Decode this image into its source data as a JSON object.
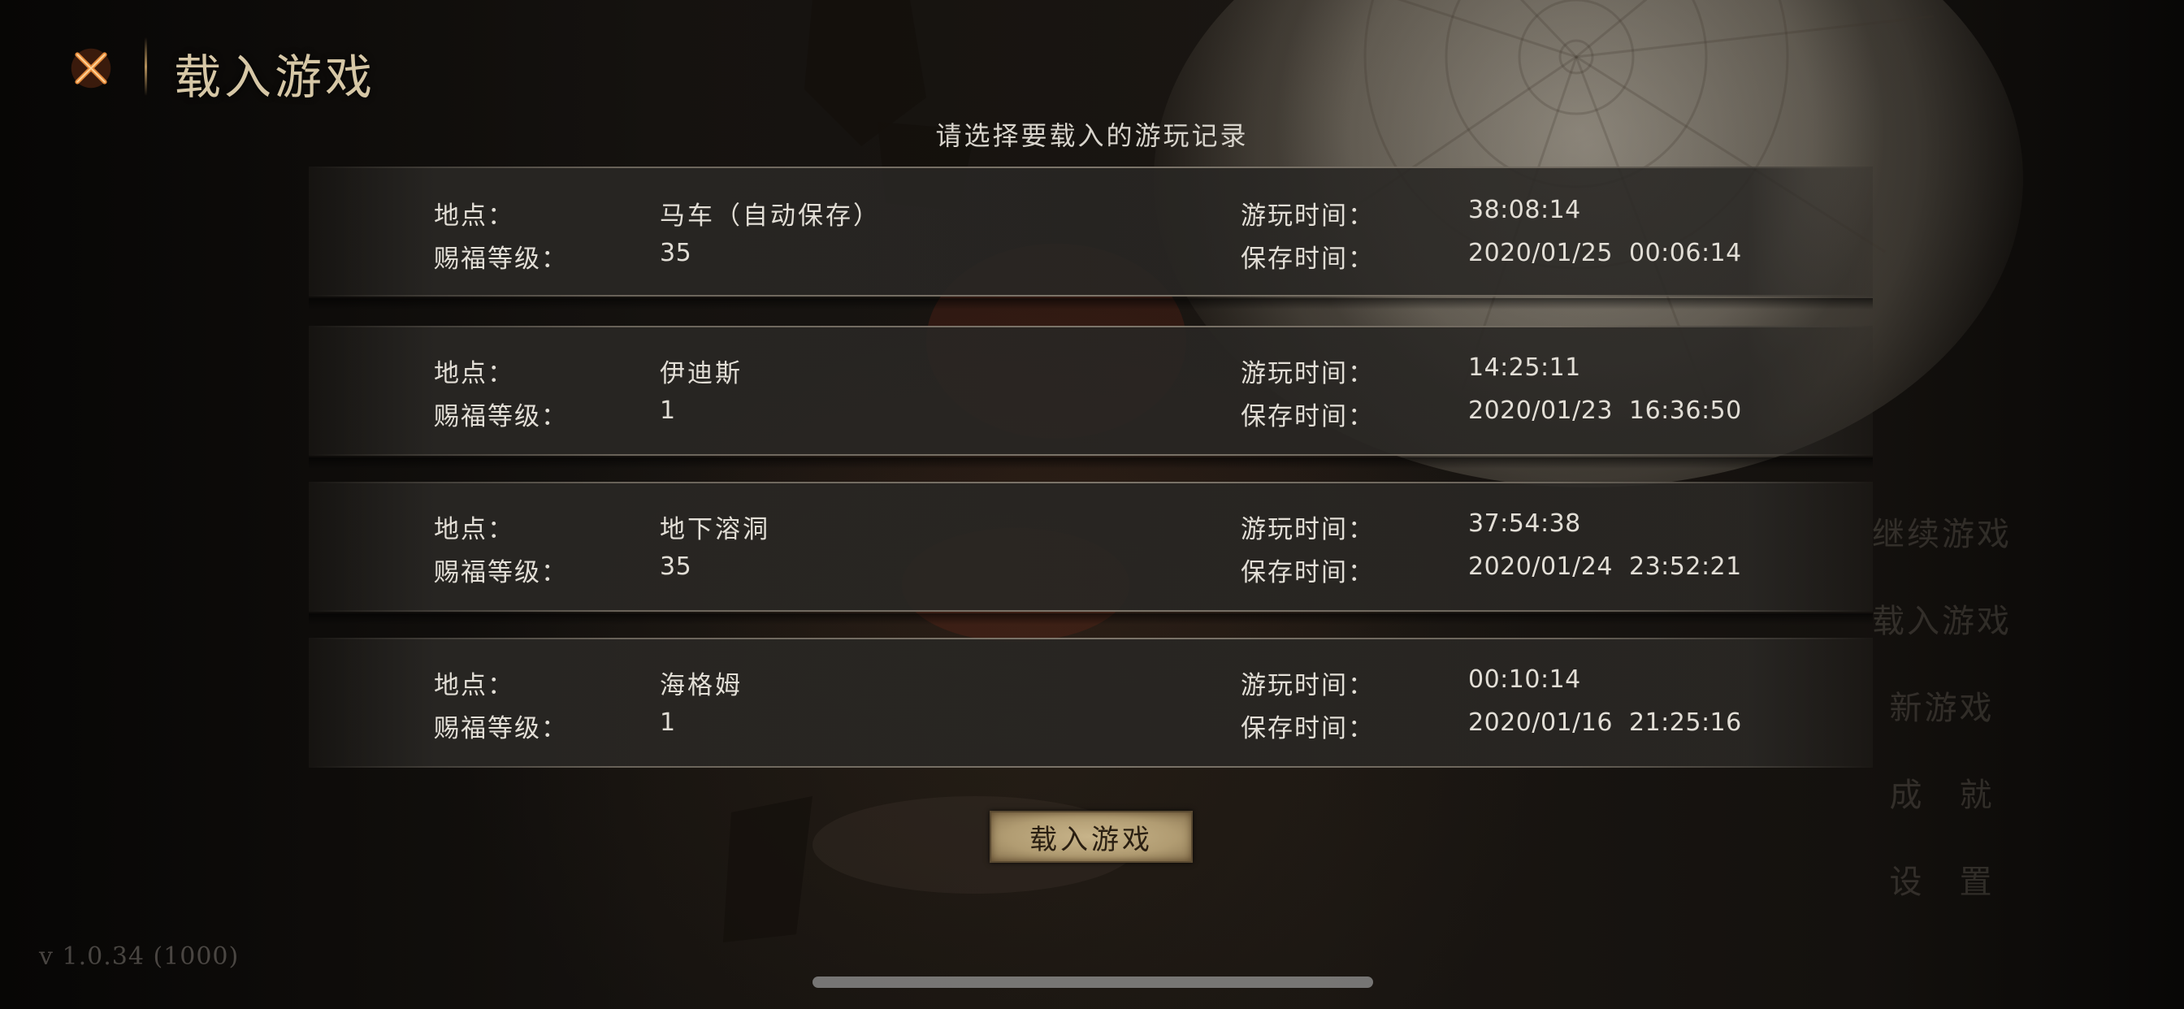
{
  "header": {
    "title": "载入游戏",
    "close_icon": "close-x-icon"
  },
  "subtitle": "请选择要载入的游玩记录",
  "labels": {
    "location": "地点：",
    "level": "赐福等级：",
    "play_time": "游玩时间：",
    "save_time": "保存时间："
  },
  "save_slots": [
    {
      "location": "马车（自动保存）",
      "level": "35",
      "play_time": "38:08:14",
      "save_time": "2020/01/25  00:06:14"
    },
    {
      "location": "伊迪斯",
      "level": "1",
      "play_time": "14:25:11",
      "save_time": "2020/01/23  16:36:50"
    },
    {
      "location": "地下溶洞",
      "level": "35",
      "play_time": "37:54:38",
      "save_time": "2020/01/24  23:52:21"
    },
    {
      "location": "海格姆",
      "level": "1",
      "play_time": "00:10:14",
      "save_time": "2020/01/16  21:25:16"
    }
  ],
  "load_button": "载入游戏",
  "main_menu": {
    "items": [
      "继续游戏",
      "载入游戏",
      "新游戏",
      "成　就",
      "设　置"
    ]
  },
  "version": "v 1.0.34 (1000)",
  "colors": {
    "accent_gold": "#d6c7a6",
    "close_icon_orange": "#e0782a",
    "button_parchment": "#b19c72",
    "text_light": "#e2ded6"
  }
}
